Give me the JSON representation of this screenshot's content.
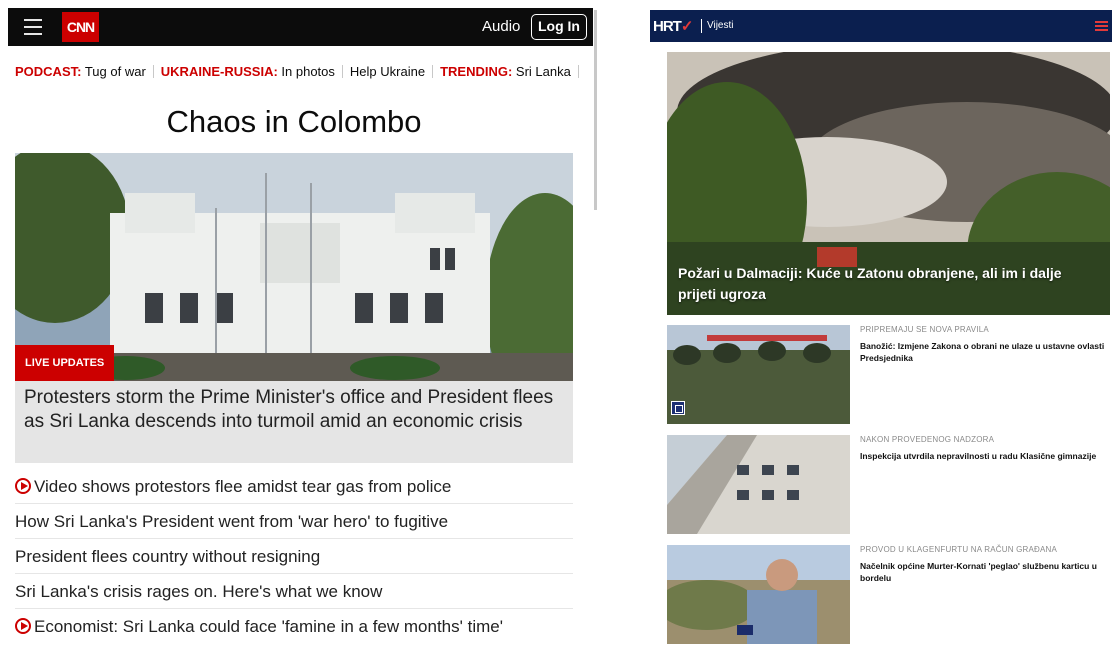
{
  "cnn": {
    "logo": "CNN",
    "audio_label": "Audio",
    "login_label": "Log In",
    "trending": [
      {
        "key": "PODCAST:",
        "text": "Tug of war"
      },
      {
        "key": "UKRAINE-RUSSIA:",
        "text": "In photos"
      },
      {
        "key": "",
        "text": "Help Ukraine"
      },
      {
        "key": "TRENDING:",
        "text": "Sri Lanka"
      }
    ],
    "headline": "Chaos in Colombo",
    "badge": "LIVE UPDATES",
    "hero_caption": "Protesters storm the Prime Minister's office and President flees as Sri Lanka descends into turmoil amid an economic crisis",
    "links": [
      {
        "text": "Video shows protestors flee amidst tear gas from police",
        "video": true
      },
      {
        "text": "How Sri Lanka's President went from 'war hero' to fugitive",
        "video": false
      },
      {
        "text": "President flees country without resigning",
        "video": false
      },
      {
        "text": "Sri Lanka's crisis rages on. Here's what we know",
        "video": false
      },
      {
        "text": "Economist: Sri Lanka could face 'famine in a few months' time'",
        "video": true
      }
    ],
    "brand_color": "#cc0000"
  },
  "hrt": {
    "logo": "HRT",
    "section": "Vijesti",
    "hero_caption": "Požari u Dalmaciji: Kuće u Zatonu obranjene, ali im i dalje prijeti ugroza",
    "items": [
      {
        "kicker": "PRIPREMAJU SE NOVA PRAVILA",
        "title": "Banožić: Izmjene Zakona o obrani ne ulaze u ustavne ovlasti Predsjednika"
      },
      {
        "kicker": "NAKON PROVEDENOG NADZORA",
        "title": "Inspekcija utvrdila nepravilnosti u radu Klasične gimnazije"
      },
      {
        "kicker": "PROVOD U KLAGENFURTU NA RAČUN GRAĐANA",
        "title": "Načelnik općine Murter-Kornati 'peglao' službenu karticu u bordelu"
      }
    ],
    "brand_color": "#0b1f4f"
  }
}
